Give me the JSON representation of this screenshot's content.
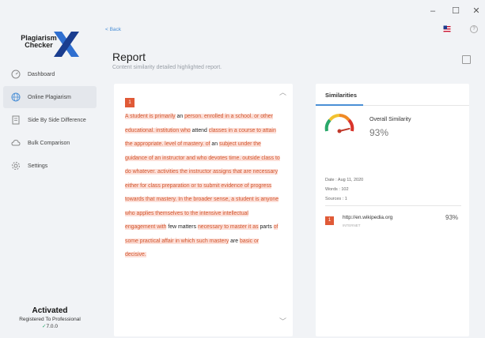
{
  "window": {
    "minimize_glyph": "–",
    "maximize_glyph": "☐",
    "close_glyph": "✕"
  },
  "sidebar": {
    "logo": {
      "line1": "Plagiarism",
      "line2": "Checker",
      "mark": "X"
    },
    "items": [
      {
        "label": "Dashboard",
        "icon": "dashboard-gauge-icon"
      },
      {
        "label": "Online Plagiarism",
        "icon": "globe-icon",
        "active": true
      },
      {
        "label": "Side By Side Difference",
        "icon": "document-icon"
      },
      {
        "label": "Bulk Comparison",
        "icon": "cloud-icon"
      },
      {
        "label": "Settings",
        "icon": "gear-icon"
      }
    ],
    "license": {
      "title": "Activated",
      "subtitle": "Registered To Professional",
      "check": "✓",
      "version": "7.0.0"
    }
  },
  "header": {
    "back_label": "< Back",
    "flag_icon": "us-flag-icon",
    "help_glyph": "?",
    "title": "Report",
    "subtitle": "Content similarity detailed highlighted report."
  },
  "report": {
    "source_badge": "1",
    "segments": [
      {
        "text": "A student is primarily",
        "hl": true
      },
      {
        "text": " an ",
        "hl": false
      },
      {
        "text": "person. enrolled in a school. or other educational. institution who",
        "hl": true
      },
      {
        "text": " attend ",
        "hl": false
      },
      {
        "text": "classes in a course to attain the appropriate. level of mastery. of",
        "hl": true
      },
      {
        "text": " an ",
        "hl": false
      },
      {
        "text": "subject under the guidance of an instructor and who devotes time. outside class to do whatever. activities the instructor assigns that are necessary either for class preparation or to submit evidence of progress towards that mastery. In the broader sense, a student is anyone who applies themselves to the intensive intellectual engagement with",
        "hl": true
      },
      {
        "text": " few matters ",
        "hl": false
      },
      {
        "text": "necessary to master it as",
        "hl": true
      },
      {
        "text": " parts ",
        "hl": false
      },
      {
        "text": "of some practical affair in which such mastery",
        "hl": true
      },
      {
        "text": " are ",
        "hl": false
      },
      {
        "text": "basic or decisive.",
        "hl": true
      }
    ]
  },
  "similarities": {
    "tab_label": "Similarities",
    "overall_label": "Overall Similarity",
    "overall_value": "93%",
    "overall_fraction": 0.93,
    "date": "Date : Aug 11, 2020",
    "words": "Words : 102",
    "sources": "Sources : 1",
    "source_rows": [
      {
        "badge": "1",
        "url": "http://en.wikipedia.org",
        "type": "INTERNET",
        "percent": "93%"
      }
    ]
  },
  "colors": {
    "accent": "#4a8fd6",
    "highlight_bg": "#fde0d9",
    "highlight_text": "#d1572f",
    "badge": "#e05a37",
    "verified": "#2aa86a"
  }
}
